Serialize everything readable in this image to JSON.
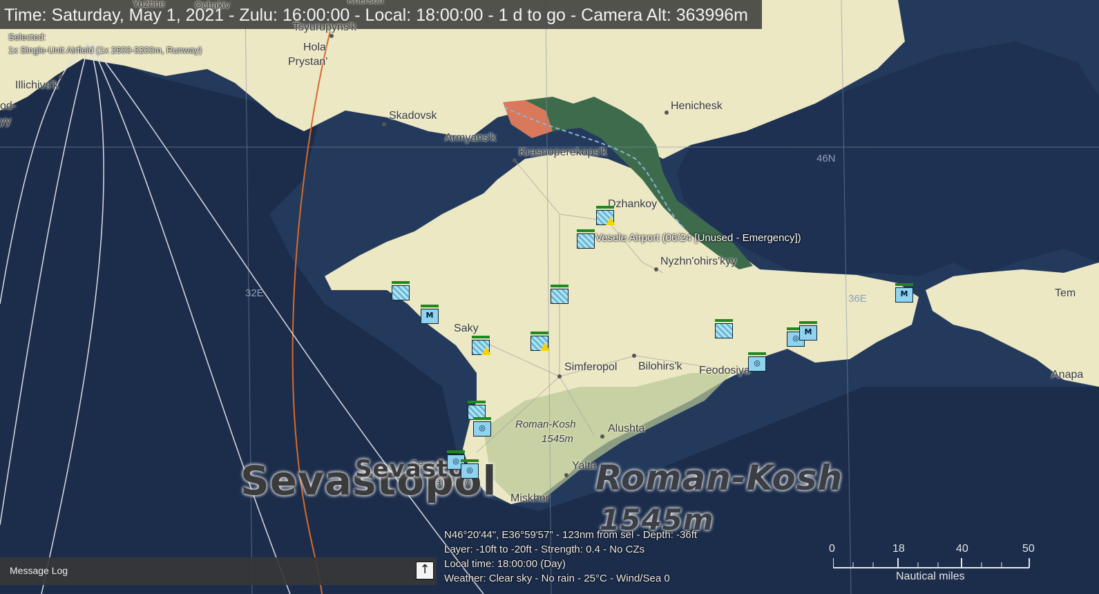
{
  "status_bar": {
    "text": "Time: Saturday, May 1, 2021 - Zulu: 16:00:00 - Local: 18:00:00 - 1 d to go -  Camera Alt: 363996m"
  },
  "selection": {
    "title": "Selected:",
    "detail": "1x Single-Unit Airfield (1x 2600-3200m, Runway)"
  },
  "places": {
    "yuzhne": "Yuzhne",
    "ochakiv": "Ochakiv",
    "kherson": "Kherson",
    "tsyurupynsk": "Tsyurupyns'k",
    "hola": "Hola",
    "prystan": "Prystan'",
    "illichivsk": "Illichivs'k",
    "od": "od-",
    "yy": "yy",
    "skadovsk": "Skadovsk",
    "armyansk": "Armyans'k",
    "krasnoperekopsk": "Krasnoperekops'k",
    "henichesk": "Henichesk",
    "dzhankoy": "Dzhankoy",
    "nyzhnohirskyy": "Nyzhn'ohirs'kyy",
    "saky": "Saky",
    "simferopol": "Simferopol",
    "bilohirsk": "Bilohirs'k",
    "feodosiya": "Feodosiya",
    "roman_kosh": "Roman-Kosh",
    "elevation": "1545m",
    "alushta": "Alushta",
    "yalta": "Yalta",
    "miskhor": "Miskhor",
    "sevasto": "Sevasto",
    "balaklava": "Balaklava",
    "tem": "Tem",
    "anapa": "Anapa"
  },
  "large_labels": {
    "sevastopol": "Sevastopol",
    "sevasto": "Sevasto",
    "roman_kosh": "Roman-Kosh",
    "elevation": "1545m"
  },
  "grid": {
    "lon_32": "32E",
    "lon_36": "36E",
    "lat_46": "46N"
  },
  "airport_label": "Vesele Airport (06/24 [Unused - Emergency])",
  "cursor_info": {
    "line1": "N46°20'44\", E36°59'57\" - 123nm from sel - Depth: -36ft",
    "line2": "Layer: -10ft to -20ft - Strength: 0.4 - No CZs",
    "line3": "Local time: 18:00:00 (Day)",
    "line4": "Weather: Clear sky - No rain - 25°C - Wind/Sea 0"
  },
  "message_log": {
    "label": "Message Log",
    "toggle_icon": "arrow-up-icon"
  },
  "scale_bar": {
    "ticks": [
      "0",
      "18",
      "40",
      "50"
    ],
    "unit": "Nautical miles"
  },
  "colors": {
    "sea_deep": "#1b2c4a",
    "sea_shallow": "#233a5c",
    "land": "#ece8c4",
    "marsh": "#3d6b4c",
    "unit_blue": "#8fd3ee",
    "unit_green": "#1e8a1e",
    "warning": "#f5d400",
    "route": "#d86a2a"
  }
}
